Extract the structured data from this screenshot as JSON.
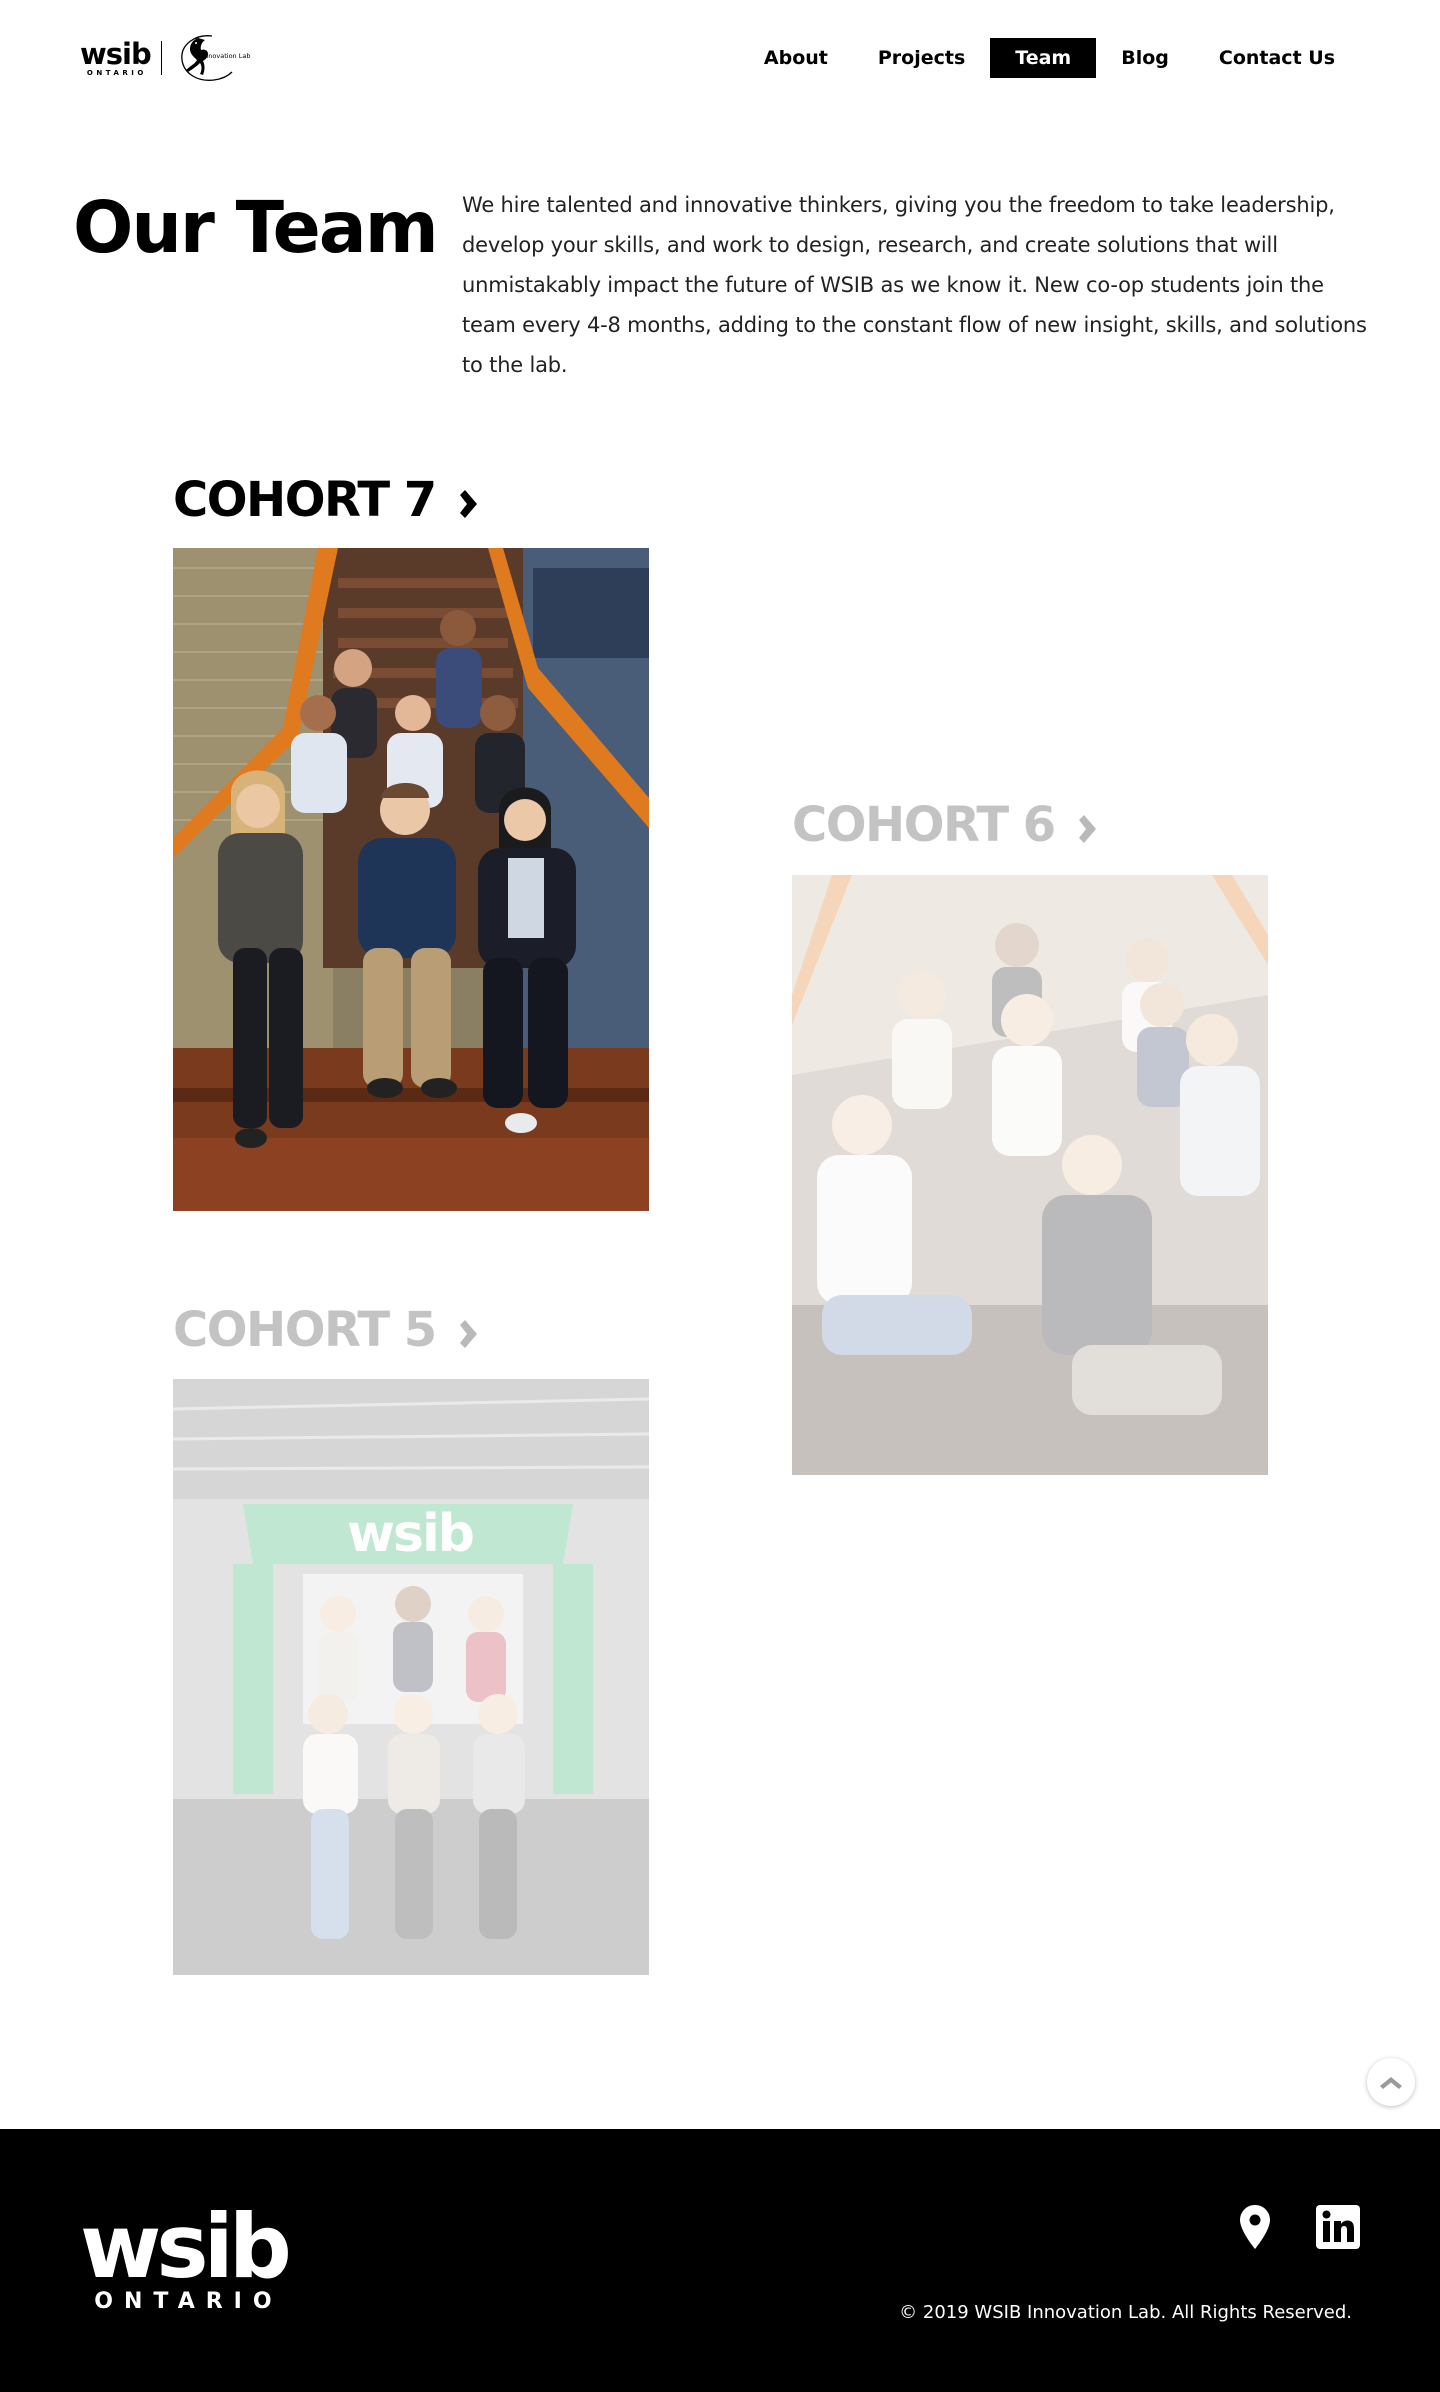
{
  "brand": {
    "logo_text": "wsib",
    "logo_subtext": "ONTARIO",
    "lab_text": "Innovation Lab"
  },
  "nav": {
    "items": [
      {
        "label": "About",
        "active": false
      },
      {
        "label": "Projects",
        "active": false
      },
      {
        "label": "Team",
        "active": true
      },
      {
        "label": "Blog",
        "active": false
      },
      {
        "label": "Contact Us",
        "active": false
      }
    ]
  },
  "hero": {
    "title": "Our Team",
    "intro": "We hire talented and innovative thinkers, giving you the freedom to take leadership, develop your skills, and work to design, research, and create solutions that will unmistakably impact the future of WSIB as we know it. New co-op students join the team every 4-8 months, adding to the constant flow of new insight, skills, and solutions to the lab."
  },
  "cohorts": [
    {
      "title": "COHORT 7",
      "arrow_icon": "chevron-right-icon",
      "photo_banner": ""
    },
    {
      "title": "COHORT 6",
      "arrow_icon": "chevron-right-icon",
      "photo_banner": ""
    },
    {
      "title": "COHORT 5",
      "arrow_icon": "chevron-right-icon",
      "photo_banner": "wsib"
    }
  ],
  "back_to_top": {
    "icon": "chevron-up-icon"
  },
  "footer": {
    "logo_text": "wsib",
    "logo_subtext": "ONTARIO",
    "icons": [
      "map-pin-icon",
      "linkedin-icon"
    ],
    "copyright": "© 2019 WSIB Innovation Lab. All Rights Reserved."
  },
  "colors": {
    "background": "#ffffff",
    "text": "#000000",
    "nav_active_bg": "#000000",
    "nav_active_text": "#ffffff",
    "dimmed_heading": "#c3c3c3",
    "footer_bg": "#000000",
    "stair_rail_orange": "#e07a1f",
    "wsib_green": "#2fb36a"
  }
}
